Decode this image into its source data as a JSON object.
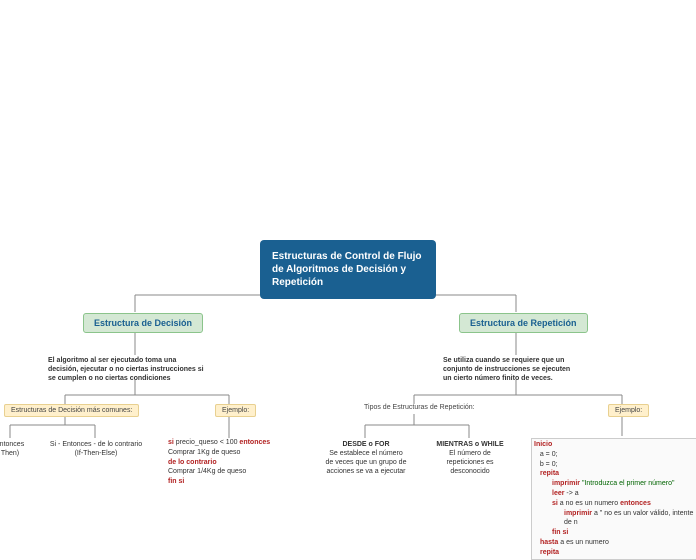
{
  "root": {
    "title": "Estructuras de Control de Flujo de Algoritmos de Decisión y Repetición"
  },
  "decision": {
    "title": "Estructura de Decisión",
    "desc_line1": "El algoritmo al ser ejecutado toma una",
    "desc_line2": "decisión, ejecutar o no ciertas instrucciones  si",
    "desc_line3": "se cumplen o no ciertas condiciones",
    "common_label": "Estructuras de Decisión más comunes:",
    "ejemplo_label": "Ejemplo:",
    "if_then": {
      "l1": "ontonces",
      "l2": "Then)"
    },
    "if_then_else": {
      "l1": "Si - Entonces - de lo contrario",
      "l2": "(If-Then-Else)"
    },
    "code": {
      "kw_si": "si",
      "cond": " precio_queso < 100 ",
      "kw_entonces": "entonces",
      "act1": "    Comprar 1Kg de queso",
      "kw_delo": "de lo contrario",
      "act2": "    Comprar 1/4Kg de queso",
      "kw_finsi": "fin si"
    }
  },
  "repeticion": {
    "title": "Estructura de Repetición",
    "desc_line1": "Se utiliza cuando se requiere que un",
    "desc_line2": "conjunto de instrucciones se ejecuten",
    "desc_line3": "un cierto número finito de veces.",
    "tipos_label": "Tipos de Estructuras de Repetición:",
    "ejemplo_label": "Ejemplo:",
    "desde": {
      "h": "DESDE o FOR",
      "l1": "Se establece el número",
      "l2": "de veces que un grupo de",
      "l3": "acciones se va a ejecutar"
    },
    "mientras": {
      "h": "MIENTRAS o WHILE",
      "l1": "El número de",
      "l2": "repeticiones es",
      "l3": "desconocido"
    },
    "code": {
      "kw_inicio": "Inicio",
      "l_a": "   a = 0;",
      "l_b": "   b = 0;",
      "kw_repita1": "repita",
      "kw_imprimir1": "imprimir ",
      "str1": "\"Introduzca el primer número\"",
      "kw_leer": "leer",
      "leer_rest": " -> a",
      "kw_si": "si",
      "si_rest": " a no es un numero ",
      "kw_entonces": "entonces",
      "kw_imprimir2": "imprimir ",
      "str2": "a \" no es un valor válido, intente de n",
      "kw_finsi": "fin si",
      "kw_hasta": "hasta",
      "hasta_rest": " a es un numero",
      "kw_repita2": "repita"
    }
  }
}
